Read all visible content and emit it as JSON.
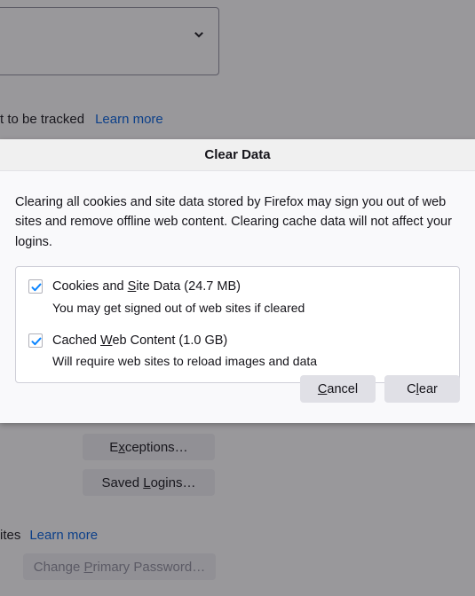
{
  "background_page": {
    "dropdown": {
      "chevron_icon": "chevron-down-icon"
    },
    "tracked_row": {
      "text": "t to be tracked",
      "learn_more_label": "Learn more"
    },
    "buttons": {
      "exceptions_label": "Exceptions…",
      "exceptions_accesskey": "x",
      "saved_logins_label": "Saved Logins…",
      "saved_logins_accesskey": "L",
      "change_primary_password_label": "Change Primary Password…",
      "change_primary_password_accesskey": "P",
      "change_primary_password_disabled": true
    },
    "sites_row": {
      "text": "ites",
      "learn_more_label": "Learn more"
    }
  },
  "dialog": {
    "title": "Clear Data",
    "description": "Clearing all cookies and site data stored by Firefox may sign you out of web sites and remove offline web content. Clearing cache data will not affect your logins.",
    "options": [
      {
        "label_before": "Cookies and ",
        "label_accesskey": "S",
        "label_after": "ite Data (24.7 MB)",
        "label_full": "Cookies and Site Data (24.7 MB)",
        "description": "You may get signed out of web sites if cleared",
        "checked": true,
        "size": "24.7 MB"
      },
      {
        "label_before": "Cached ",
        "label_accesskey": "W",
        "label_after": "eb Content (1.0 GB)",
        "label_full": "Cached Web Content (1.0 GB)",
        "description": "Will require web sites to reload images and data",
        "checked": true,
        "size": "1.0 GB"
      }
    ],
    "cancel": {
      "before": "",
      "accesskey": "C",
      "after": "ancel",
      "full": "Cancel"
    },
    "clear": {
      "before": "C",
      "accesskey": "l",
      "after": "ear",
      "full": "Clear"
    }
  },
  "colors": {
    "accent_blue": "#0a84ff",
    "link_blue": "#0060df",
    "dialog_bg": "#f9f9fb",
    "titlebar_bg": "#f0f0f0",
    "button_bg": "#e0e0e6",
    "text": "#15141a",
    "disabled_text": "#8f8f9d"
  }
}
